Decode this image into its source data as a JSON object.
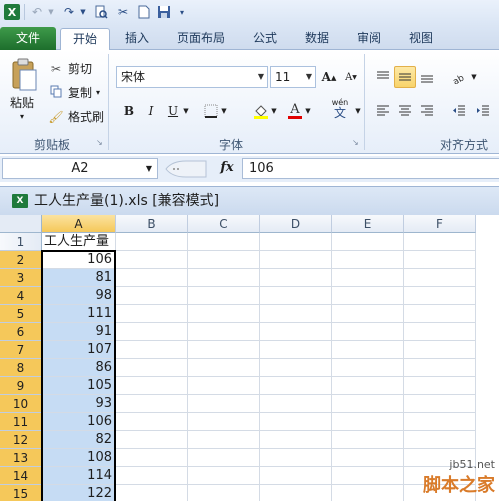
{
  "qat": {
    "icons": [
      "excel-logo-icon",
      "undo-icon",
      "redo-icon",
      "print-preview-icon",
      "cut-tool-icon",
      "new-icon",
      "save-icon",
      "dropdown-icon"
    ]
  },
  "tabs": [
    {
      "label": "文件"
    },
    {
      "label": "开始"
    },
    {
      "label": "插入"
    },
    {
      "label": "页面布局"
    },
    {
      "label": "公式"
    },
    {
      "label": "数据"
    },
    {
      "label": "审阅"
    },
    {
      "label": "视图"
    }
  ],
  "ribbon": {
    "clipboard": {
      "paste": "粘贴",
      "cut": "剪切",
      "copy": "复制",
      "format_painter": "格式刷",
      "group_label": "剪贴板"
    },
    "font": {
      "font_name": "宋体",
      "font_size": "11",
      "bold": "B",
      "italic": "I",
      "underline": "U",
      "group_label": "字体",
      "wen": "wén"
    },
    "alignment": {
      "group_label": "对齐方式"
    }
  },
  "formula_bar": {
    "name_box": "A2",
    "fx": "fx",
    "value": "106"
  },
  "workbook": {
    "title": "工人生产量(1).xls  [兼容模式]"
  },
  "sheet": {
    "columns": [
      "A",
      "B",
      "C",
      "D",
      "E",
      "F"
    ],
    "rows": [
      {
        "num": "1",
        "a": "工人生产量"
      },
      {
        "num": "2",
        "a": "106"
      },
      {
        "num": "3",
        "a": "81"
      },
      {
        "num": "4",
        "a": "98"
      },
      {
        "num": "5",
        "a": "111"
      },
      {
        "num": "6",
        "a": "91"
      },
      {
        "num": "7",
        "a": "107"
      },
      {
        "num": "8",
        "a": "86"
      },
      {
        "num": "9",
        "a": "105"
      },
      {
        "num": "10",
        "a": "93"
      },
      {
        "num": "11",
        "a": "106"
      },
      {
        "num": "12",
        "a": "82"
      },
      {
        "num": "13",
        "a": "108"
      },
      {
        "num": "14",
        "a": "114"
      },
      {
        "num": "15",
        "a": "122"
      }
    ]
  },
  "watermark": {
    "line1": "jb51.net",
    "line2": "脚本之家"
  }
}
